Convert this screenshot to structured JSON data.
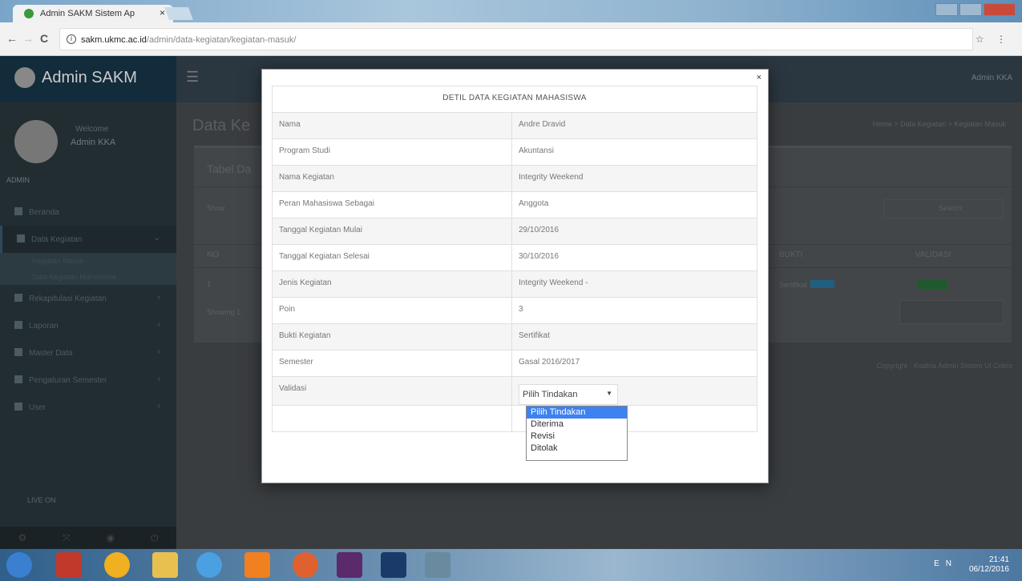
{
  "browser": {
    "tab_title": "Admin SAKM Sistem Ap",
    "tab_close": "×",
    "url_domain": "sakm.ukmc.ac.id",
    "url_path": "/admin/data-kegiatan/kegiatan-masuk/",
    "back": "←",
    "forward": "→",
    "reload": "C"
  },
  "app": {
    "logo": "Admin SAKM",
    "user_greeting": "Welcome",
    "user_name": "Admin KKA",
    "role": "ADMIN",
    "top_right_user": "Admin KKA",
    "sidebar_footer": "LIVE ON",
    "menu": [
      {
        "label": "Beranda"
      },
      {
        "label": "Data Kegiatan",
        "active": true
      },
      {
        "label": "Rekapitulasi Kegiatan"
      },
      {
        "label": "Laporan"
      },
      {
        "label": "Master Data"
      },
      {
        "label": "Pengaturan Semester"
      },
      {
        "label": "User"
      }
    ],
    "submenu": [
      "Kegiatan Masuk",
      "Data Kegiatan Mahasiswa"
    ]
  },
  "content": {
    "title": "Data Ke",
    "breadcrumb": "Home > Data Kegiatan > Kegiatan Masuk",
    "box_title": "Tabel Da",
    "show_label": "Show",
    "search_label": "Search:",
    "col_no": "NO",
    "col_bukti": "BUKTI",
    "col_validasi": "VALIDASI",
    "row_no": "1",
    "row_bukti": "Sertifikat",
    "showing": "Showing 1",
    "pager": "Previous  Next",
    "copyright": "Copyright · Ksatria Admin Sistem Ui Cokro"
  },
  "modal": {
    "title": "DETIL DATA KEGIATAN MAHASISWA",
    "close": "×",
    "rows": [
      {
        "label": "Nama",
        "value": "Andre Dravid"
      },
      {
        "label": "Program Studi",
        "value": "Akuntansi"
      },
      {
        "label": "Nama Kegiatan",
        "value": "Integrity Weekend"
      },
      {
        "label": "Peran Mahasiswa Sebagai",
        "value": "Anggota"
      },
      {
        "label": "Tanggal Kegiatan Mulai",
        "value": "29/10/2016"
      },
      {
        "label": "Tanggal Kegiatan Selesai",
        "value": "30/10/2016"
      },
      {
        "label": "Jenis Kegiatan",
        "value": "Integrity Weekend -"
      },
      {
        "label": "Poin",
        "value": "3"
      },
      {
        "label": "Bukti Kegiatan",
        "value": "Sertifikat"
      },
      {
        "label": "Semester",
        "value": "Gasal 2016/2017"
      }
    ],
    "validasi_label": "Validasi",
    "select_value": "Pilih Tindakan",
    "options": [
      "Pilih Tindakan",
      "Diterima",
      "Revisi",
      "Ditolak"
    ]
  },
  "taskbar": {
    "lang": "EN",
    "time": "21:41",
    "date": "06/12/2016"
  }
}
